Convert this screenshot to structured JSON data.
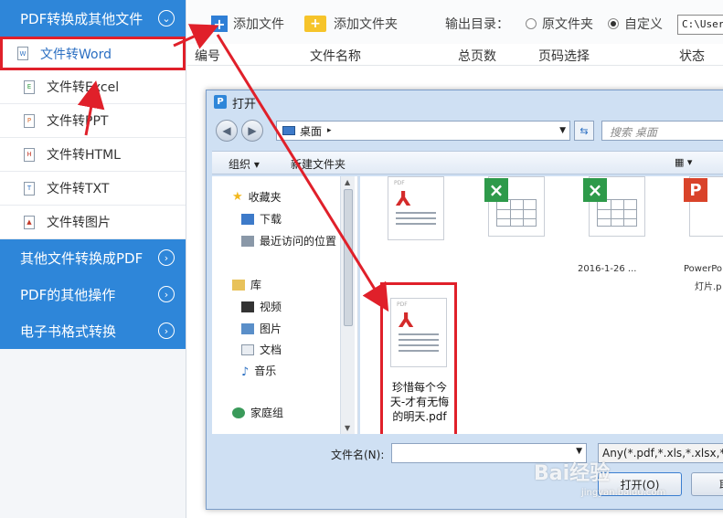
{
  "sidebar": {
    "sections": [
      {
        "label": "PDF转换成其他文件",
        "icon": "chevron-down-icon"
      },
      {
        "label": "其他文件转换成PDF",
        "icon": "chevron-right-icon"
      },
      {
        "label": "PDF的其他操作",
        "icon": "chevron-right-icon"
      },
      {
        "label": "电子书格式转换",
        "icon": "chevron-right-icon"
      }
    ],
    "items": [
      {
        "label": "文件转Word",
        "icon": "word-file-icon",
        "glyph": "W"
      },
      {
        "label": "文件转Excel",
        "icon": "excel-file-icon",
        "glyph": "E"
      },
      {
        "label": "文件转PPT",
        "icon": "ppt-file-icon",
        "glyph": "P"
      },
      {
        "label": "文件转HTML",
        "icon": "html-file-icon",
        "glyph": "H"
      },
      {
        "label": "文件转TXT",
        "icon": "txt-file-icon",
        "glyph": "T"
      },
      {
        "label": "文件转图片",
        "icon": "image-file-icon",
        "glyph": "▲"
      }
    ]
  },
  "toolbar": {
    "add_file": "添加文件",
    "add_folder": "添加文件夹",
    "output_label": "输出目录：",
    "radio_original": "原文件夹",
    "radio_custom": "自定义",
    "path_value": "C:\\Users"
  },
  "columns": [
    "编号",
    "文件名称",
    "总页数",
    "页码选择",
    "状态"
  ],
  "dialog": {
    "title": "打开",
    "address": "桌面",
    "search_placeholder": "搜索 桌面",
    "cmd_organize": "组织 ▾",
    "cmd_new_folder": "新建文件夹",
    "nav": {
      "favorites": "收藏夹",
      "downloads": "下载",
      "recent": "最近访问的位置",
      "library": "库",
      "videos": "视频",
      "pictures": "图片",
      "documents": "文档",
      "music": "音乐",
      "homegroup": "家庭组"
    },
    "files": {
      "selected_name": "珍惜每个今天-才有无悔的明天.pdf",
      "cut_label_1": "2016-1-26 ...",
      "cut_label_2": "PowerPo",
      "cut_label_3": "灯片.p"
    },
    "filename_label": "文件名(N):",
    "filename_value": "",
    "filetype_value": "Any(*.pdf,*.xls,*.xlsx,*.pp",
    "open_button": "打开(O)",
    "cancel_button": "取"
  },
  "watermark": {
    "main": "Bai经验",
    "sub": "jingyan.baidu.com"
  },
  "colors": {
    "sidebar_blue": "#2e86d9",
    "annotation_red": "#e0202a"
  }
}
